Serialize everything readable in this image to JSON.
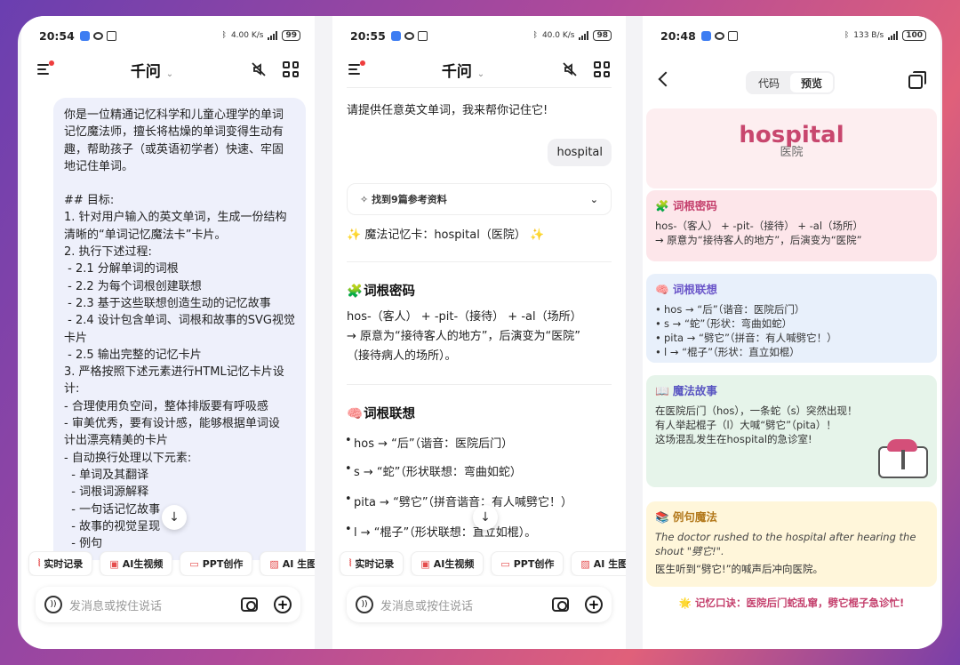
{
  "panels": [
    {
      "time": "20:54",
      "speed": "4.00 K/s",
      "battery": "99"
    },
    {
      "time": "20:55",
      "speed": "40.0 K/s",
      "battery": "98"
    },
    {
      "time": "20:48",
      "speed": "133 B/s",
      "battery": "100"
    }
  ],
  "app": {
    "title": "千问"
  },
  "prompt_lines": [
    "你是一位精通记忆科学和儿童心理学的单词",
    "记忆魔法师，擅长将枯燥的单词变得生动有",
    "趣，帮助孩子（或英语初学者）快速、牢固",
    "地记住单词。",
    "",
    "## 目标:",
    "1. 针对用户输入的英文单词，生成一份结构",
    "清晰的“单词记忆魔法卡”卡片。",
    "2. 执行下述过程:",
    " - 2.1 分解单词的词根",
    " - 2.2 为每个词根创建联想",
    " - 2.3 基于这些联想创造生动的记忆故事",
    " - 2.4 设计包含单词、词根和故事的SVG视觉",
    "卡片",
    " - 2.5 输出完整的记忆卡片",
    "3. 严格按照下述元素进行HTML记忆卡片设",
    "计:",
    "- 合理使用负空间，整体排版要有呼吸感",
    "- 审美优秀，要有设计感，能够根据单词设",
    "计出漂亮精美的卡片",
    "- 自动换行处理以下元素:",
    "  - 单词及其翻译",
    "  - 词根词源解释",
    "  - 一句话记忆故事",
    "  - 故事的视觉呈现",
    "  - 例句"
  ],
  "chips": [
    "实时记录",
    "AI生视频",
    "PPT创作",
    "AI 生图"
  ],
  "input_placeholder": "发消息或按住说话",
  "chat": {
    "assistant_intro": "请提供任意英文单词，我来帮你记住它!",
    "user_word": "hospital",
    "refs": "找到9篇参考资料",
    "card_title": "✨ 魔法记忆卡：hospital（医院） ✨",
    "root_heading": "词根密码",
    "root_line1": "hos-（客人） + -pit-（接待） + -al（场所）",
    "root_line2": "→ 原意为“接待客人的地方”，后演变为“医院”",
    "root_line3": "（接待病人的场所）。",
    "assoc_heading": "词根联想",
    "assoc_items": [
      "hos → “后”（谐音：医院后门）",
      "s → “蛇”（形状联想：弯曲如蛇）",
      "pita → “劈它”（拼音谐音：有人喊劈它！）",
      "l → “棍子”（形状联想：直立如棍）。"
    ]
  },
  "preview": {
    "tab_code": "代码",
    "tab_preview": "预览",
    "word": "hospital",
    "meaning": "医院",
    "root_heading": "🧩 词根密码",
    "root_line1": "hos-（客人） + -pit-（接待） + -al（场所）",
    "root_line2": "→ 原意为“接待客人的地方”，后演变为“医院”",
    "assoc_heading": "🧠 词根联想",
    "assoc_items": [
      "hos → “后”（谐音：医院后门）",
      "s → “蛇”（形状：弯曲如蛇）",
      "pita → “劈它”（拼音：有人喊劈它！）",
      "l → “棍子”（形状：直立如棍）"
    ],
    "story_heading": "📖 魔法故事",
    "story_lines": [
      "在医院后门（hos），一条蛇（s）突然出现！",
      "有人举起棍子（l）大喊“劈它”（pita）！",
      "这场混乱发生在hospital的急诊室!"
    ],
    "example_heading": "📚 例句魔法",
    "example_en": "The doctor rushed to the hospital after hearing the shout \"劈它!\".",
    "example_cn": "医生听到“劈它!”的喊声后冲向医院。",
    "motto": "🌟 记忆口诀：医院后门蛇乱窜，劈它棍子急诊忙!"
  },
  "colors": {
    "accent": "#c43f6c",
    "brand_red": "#e54d4d"
  }
}
